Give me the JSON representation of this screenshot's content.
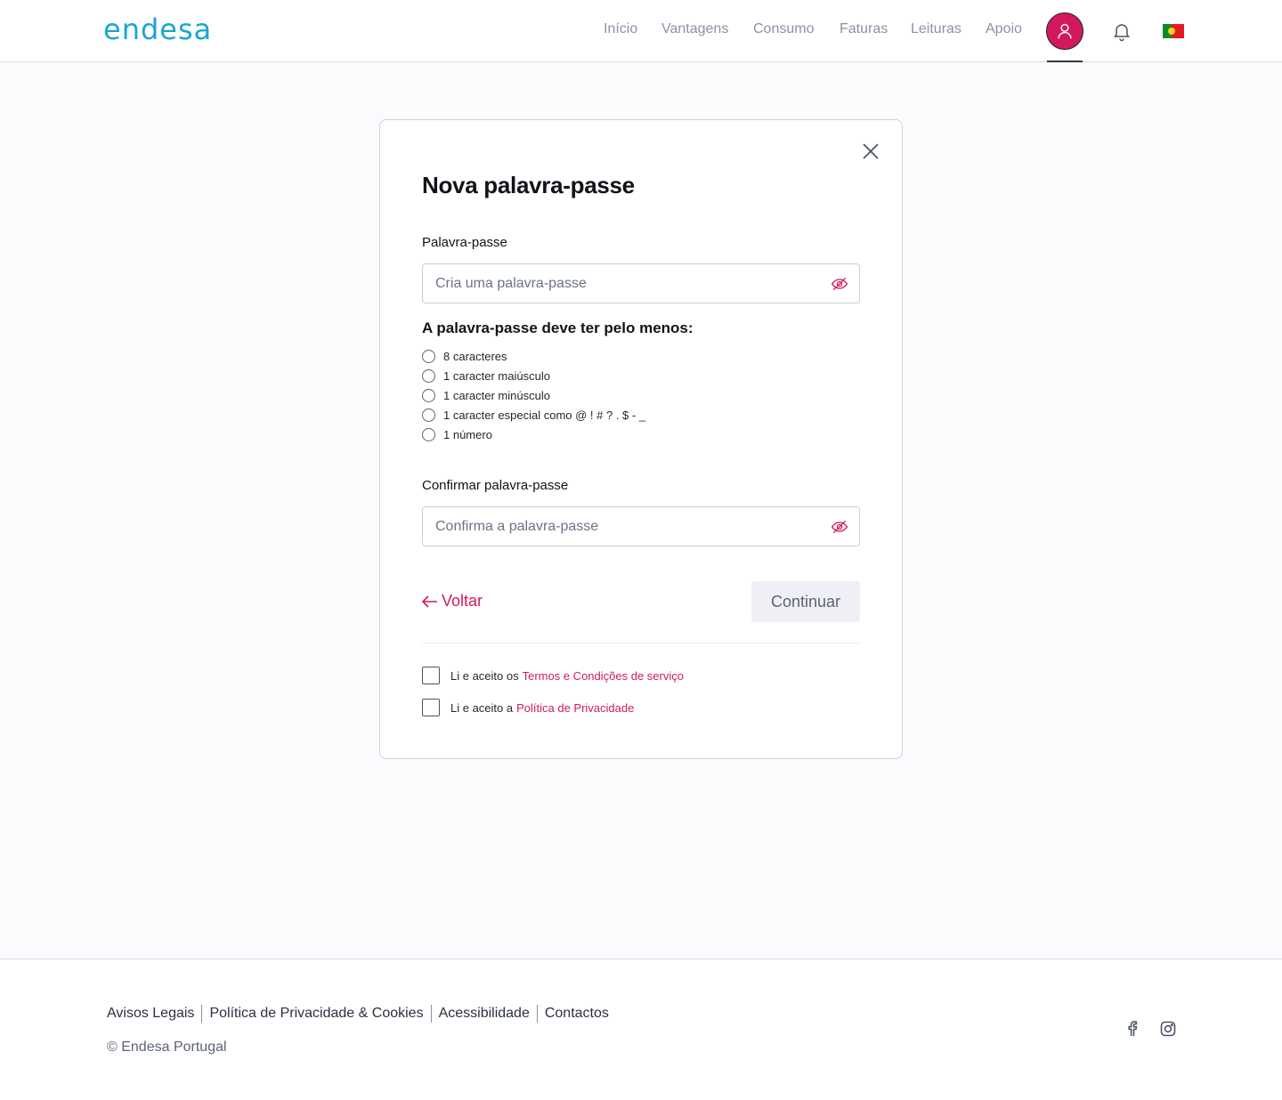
{
  "header": {
    "logo": "endesa",
    "nav": [
      "Início",
      "Vantagens",
      "Consumo",
      "Faturas",
      "Leituras",
      "Apoio"
    ]
  },
  "modal": {
    "title": "Nova palavra-passe",
    "password_label": "Palavra-passe",
    "password_placeholder": "Cria uma palavra-passe",
    "requirements_title": "A palavra-passe deve ter pelo menos:",
    "requirements": [
      "8 caracteres",
      "1 caracter maiúsculo",
      "1 caracter minúsculo",
      "1 caracter especial como @ ! # ? . $ - _",
      "1 número"
    ],
    "confirm_label": "Confirmar palavra-passe",
    "confirm_placeholder": "Confirma a palavra-passe",
    "back_label": "Voltar",
    "continue_label": "Continuar",
    "terms_prefix": "Li e aceito os",
    "terms_link": "Termos e Condições de serviço",
    "privacy_prefix": "Li e aceito a",
    "privacy_link": "Política de Privacidade"
  },
  "footer": {
    "links": [
      "Avisos Legais",
      "Política de Privacidade & Cookies",
      "Acessibilidade",
      "Contactos"
    ],
    "copyright": "© Endesa Portugal"
  },
  "colors": {
    "brand_pink": "#d3195e",
    "logo_blue": "#1aa6d0"
  },
  "icons": [
    "user-icon",
    "bell-icon",
    "flag-portugal-icon",
    "close-icon",
    "eye-off-icon",
    "arrow-left-icon",
    "facebook-icon",
    "instagram-icon"
  ]
}
